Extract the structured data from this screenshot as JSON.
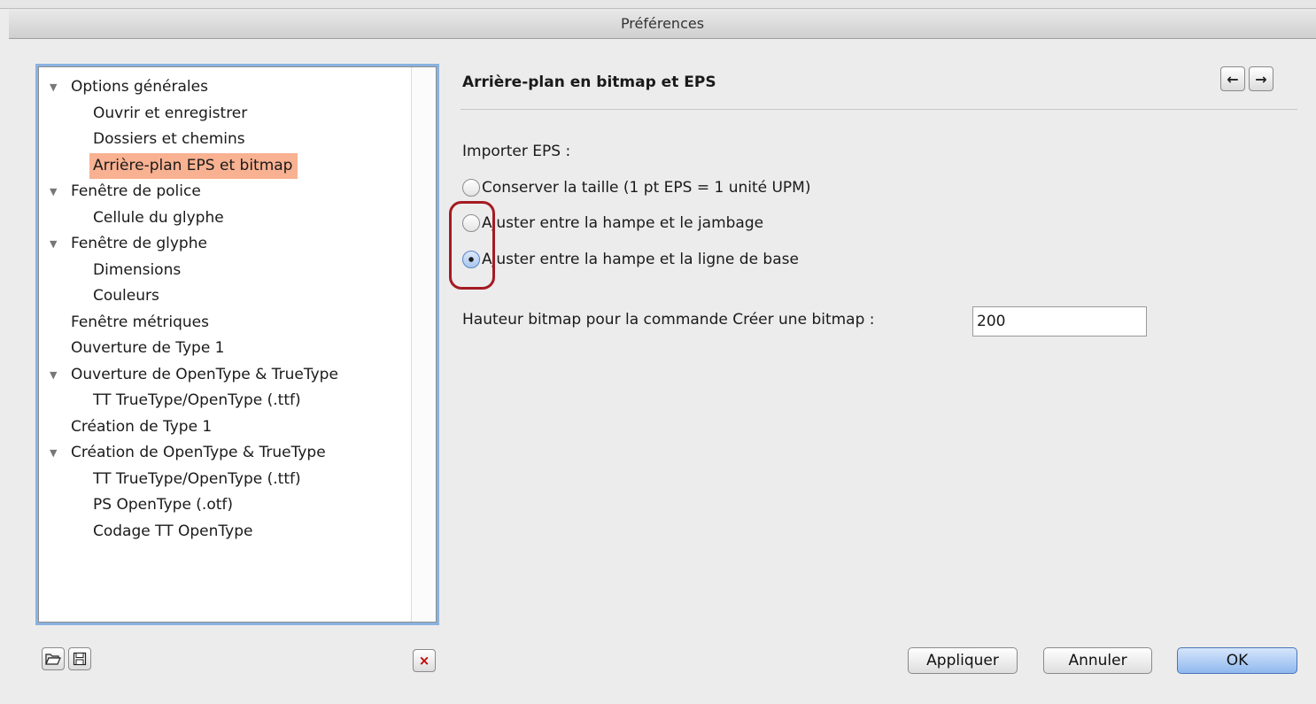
{
  "window": {
    "title": "Préférences"
  },
  "tree": {
    "items": [
      {
        "label": "Options générales",
        "expandable": true
      },
      {
        "label": "Ouvrir et enregistrer"
      },
      {
        "label": "Dossiers et chemins"
      },
      {
        "label": "Arrière-plan EPS et bitmap",
        "selected": true
      },
      {
        "label": "Fenêtre de police",
        "expandable": true
      },
      {
        "label": "Cellule du glyphe"
      },
      {
        "label": "Fenêtre de glyphe",
        "expandable": true
      },
      {
        "label": "Dimensions"
      },
      {
        "label": "Couleurs"
      },
      {
        "label": "Fenêtre métriques"
      },
      {
        "label": "Ouverture de Type 1"
      },
      {
        "label": "Ouverture de OpenType & TrueType",
        "expandable": true
      },
      {
        "label": "TT TrueType/OpenType (.ttf)"
      },
      {
        "label": "Création de Type 1"
      },
      {
        "label": "Création de OpenType & TrueType",
        "expandable": true
      },
      {
        "label": "TT TrueType/OpenType (.ttf)"
      },
      {
        "label": "PS OpenType (.otf)"
      },
      {
        "label": "Codage TT OpenType"
      }
    ]
  },
  "panel": {
    "title": "Arrière-plan en bitmap et EPS",
    "import_label": "Importer EPS :",
    "radio_options": [
      {
        "label": "Conserver la taille (1 pt EPS = 1 unité UPM)",
        "checked": false
      },
      {
        "label": "Ajuster entre la hampe et le jambage",
        "checked": false
      },
      {
        "label": "Ajuster entre la hampe et la ligne de base",
        "checked": true
      }
    ],
    "bitmap_label": "Hauteur bitmap pour la commande Créer une bitmap :",
    "bitmap_value": "200"
  },
  "buttons": {
    "apply": "Appliquer",
    "cancel": "Annuler",
    "ok": "OK",
    "prev_icon": "←",
    "next_icon": "→",
    "delete_icon": "×",
    "open_icon": "open-folder-icon",
    "save_icon": "save-disk-icon"
  },
  "colors": {
    "selection": "#f8b191",
    "highlight_oval": "#a41b22",
    "focus_ring": "#8ab2e0",
    "ok_button": "#8fb8ee"
  }
}
